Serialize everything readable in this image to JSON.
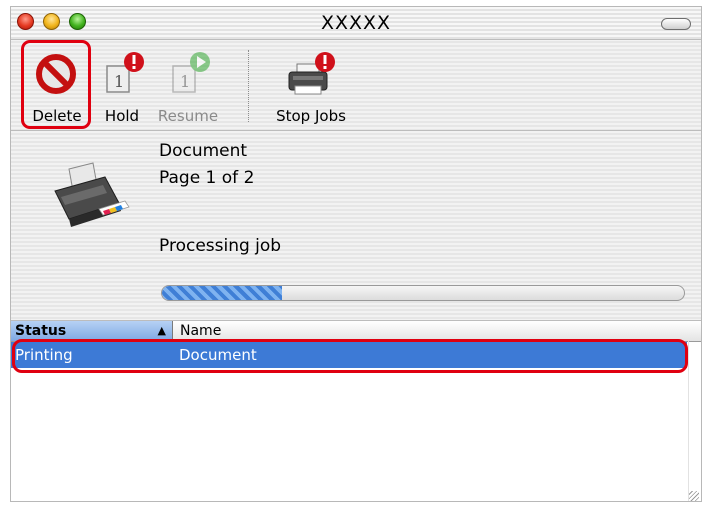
{
  "window": {
    "title": "XXXXX"
  },
  "toolbar": {
    "delete_label": "Delete",
    "hold_label": "Hold",
    "resume_label": "Resume",
    "stop_jobs_label": "Stop Jobs"
  },
  "job": {
    "document": "Document",
    "page": "Page 1 of 2",
    "status": "Processing job",
    "progress_fraction": 0.23
  },
  "table": {
    "columns": [
      "Status",
      "Name"
    ],
    "rows": [
      {
        "status": "Printing",
        "name": "Document"
      }
    ]
  },
  "colors": {
    "highlight_outline": "#e00010",
    "selection": "#3d7ad6"
  }
}
